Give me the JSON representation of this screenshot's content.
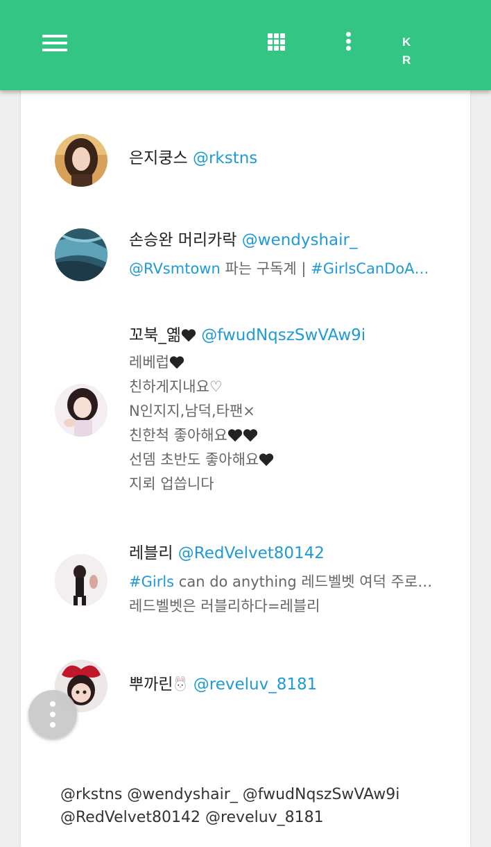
{
  "topbar": {
    "color": "#34c584",
    "menu_icon": "hamburger-menu-icon",
    "grid_icon": "apps-grid-icon",
    "more_icon": "more-vert-icon",
    "lang_label": "K R"
  },
  "users": [
    {
      "name": "은지쿵스",
      "handle": "@rkstns",
      "bio": []
    },
    {
      "name": "손승완 머리카락",
      "handle": "@wendyshair_",
      "bio_tag1": "@RVsmtown",
      "bio_mid": " 파는 구독계 | ",
      "bio_tag2": "#GirlsCanDoA…"
    },
    {
      "name": "꼬북_옒",
      "handle": "@fwudNqszSwVAw9i",
      "bio": [
        "레베럽",
        "친하게지내요♡",
        "N인지지,남덕,타팬×",
        "친한척 좋아해요",
        "선뎀 초반도 좋아해요",
        "지뢰 업씁니다"
      ]
    },
    {
      "name": "레블리",
      "handle": "@RedVelvet80142",
      "bio_tag": "#Girls",
      "bio_rest": " can do anything 레드벨벳 여덕 주로…",
      "bio_line2": "레드벨벳은 러블리하다=레블리"
    },
    {
      "name": "뿌까린",
      "handle": "@reveluv_8181"
    }
  ],
  "mentions": {
    "line1": "@rkstns @wendyshair_ @fwudNqszSwVAw9i",
    "line2": "@RedVelvet80142 @reveluv_8181"
  },
  "colors": {
    "link": "#1f9ad6",
    "name_text": "#222222",
    "bio_text": "#666666"
  },
  "fab_icon": "more-vert-icon"
}
